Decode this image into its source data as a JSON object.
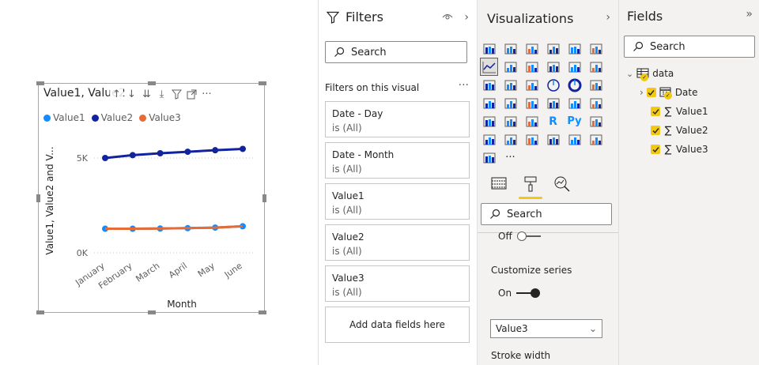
{
  "canvas": {
    "visual": {
      "title": "Value1, Value2 and Value3 by Month",
      "toolbar_icons": [
        "arrow-up-icon",
        "arrow-down-icon",
        "double-arrow-down-icon",
        "expand-down-icon",
        "filter-icon",
        "focus-mode-icon",
        "more-options-icon"
      ],
      "more_label": "···"
    }
  },
  "chart_data": {
    "type": "line",
    "categories": [
      "January",
      "February",
      "March",
      "April",
      "May",
      "June"
    ],
    "series": [
      {
        "name": "Value1",
        "color": "#118dff",
        "values": [
          1270,
          1270,
          1280,
          1300,
          1330,
          1400
        ]
      },
      {
        "name": "Value2",
        "color": "#12239e",
        "values": [
          5000,
          5150,
          5250,
          5330,
          5410,
          5480
        ]
      },
      {
        "name": "Value3",
        "color": "#e66c37",
        "values": [
          1270,
          1270,
          1280,
          1300,
          1330,
          1400
        ]
      }
    ],
    "xlabel": "Month",
    "ylabel": "Value1, Value2 and V...",
    "yticks": [
      {
        "value": 0,
        "label": "0K"
      },
      {
        "value": 5000,
        "label": "5K"
      }
    ],
    "ylim": [
      0,
      6000
    ],
    "grid": true,
    "legend_position": "top-left"
  },
  "filters": {
    "title": "Filters",
    "search_placeholder": "Search",
    "section_label": "Filters on this visual",
    "more": "···",
    "cards": [
      {
        "field": "Date - Day",
        "state": "is (All)"
      },
      {
        "field": "Date - Month",
        "state": "is (All)"
      },
      {
        "field": "Value1",
        "state": "is (All)"
      },
      {
        "field": "Value2",
        "state": "is (All)"
      },
      {
        "field": "Value3",
        "state": "is (All)"
      }
    ],
    "add_fields": "Add data fields here"
  },
  "visualizations": {
    "title": "Visualizations",
    "more": "···",
    "search_placeholder": "Search",
    "off_label": "Off",
    "customize_series_label": "Customize series",
    "on_label": "On",
    "series_selected": "Value3",
    "stroke_width_label": "Stroke width",
    "accent_color": "#f2c811"
  },
  "fields": {
    "title": "Fields",
    "search_placeholder": "Search",
    "table_name": "data",
    "items": [
      {
        "label": "Date"
      },
      {
        "label": "Value1"
      },
      {
        "label": "Value2"
      },
      {
        "label": "Value3"
      }
    ]
  }
}
